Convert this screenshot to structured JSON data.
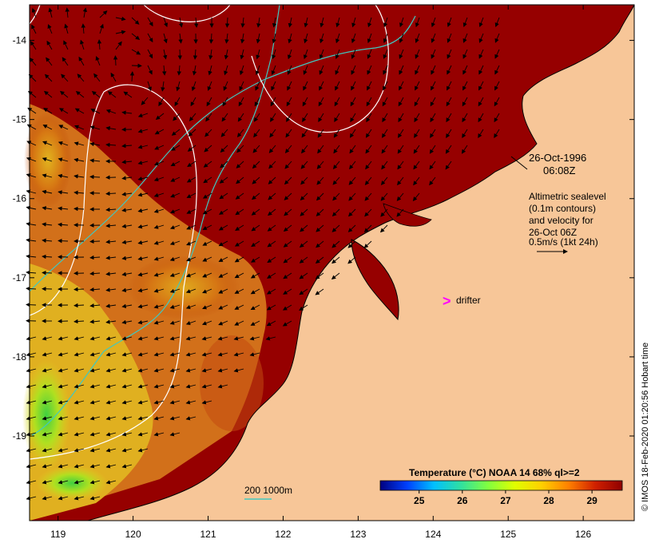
{
  "axes": {
    "lon_ticks": [
      "119",
      "120",
      "121",
      "122",
      "123",
      "124",
      "125",
      "126"
    ],
    "lat_ticks": [
      "-14",
      "-15",
      "-16",
      "-17",
      "-18",
      "-19"
    ],
    "lon_range": [
      118.62,
      126.68
    ],
    "lat_range": [
      -13.55,
      -20.07
    ]
  },
  "annotation": {
    "date": "26-Oct-1996",
    "time": "06:08Z",
    "lines": [
      "Altimetric sealevel",
      "(0.1m contours)",
      "and velocity for",
      "26-Oct 06Z",
      "0.5m/s (1kt 24h)"
    ],
    "drifter_label": "drifter",
    "drifter_symbol": ">"
  },
  "depth_legend": {
    "label": "200  1000m"
  },
  "colorbar": {
    "title": "Temperature (°C) NOAA 14 68% ql>=2",
    "tick_labels": [
      "25",
      "26",
      "27",
      "28",
      "29"
    ],
    "range": [
      24.1,
      29.7
    ],
    "stops": [
      "#000080",
      "#0040ff",
      "#00c0ff",
      "#30e0a0",
      "#80ff40",
      "#e0ff00",
      "#ffd000",
      "#ff8000",
      "#d02000",
      "#900000"
    ]
  },
  "credit": "© IMOS 18-Feb-2020 01:20:56 Hobart time",
  "colors": {
    "land": "#f7c698",
    "warm_sea": "#960000",
    "contour": "#ffffff",
    "isobath": "#40c8c0",
    "drifter": "#ff00ff"
  }
}
